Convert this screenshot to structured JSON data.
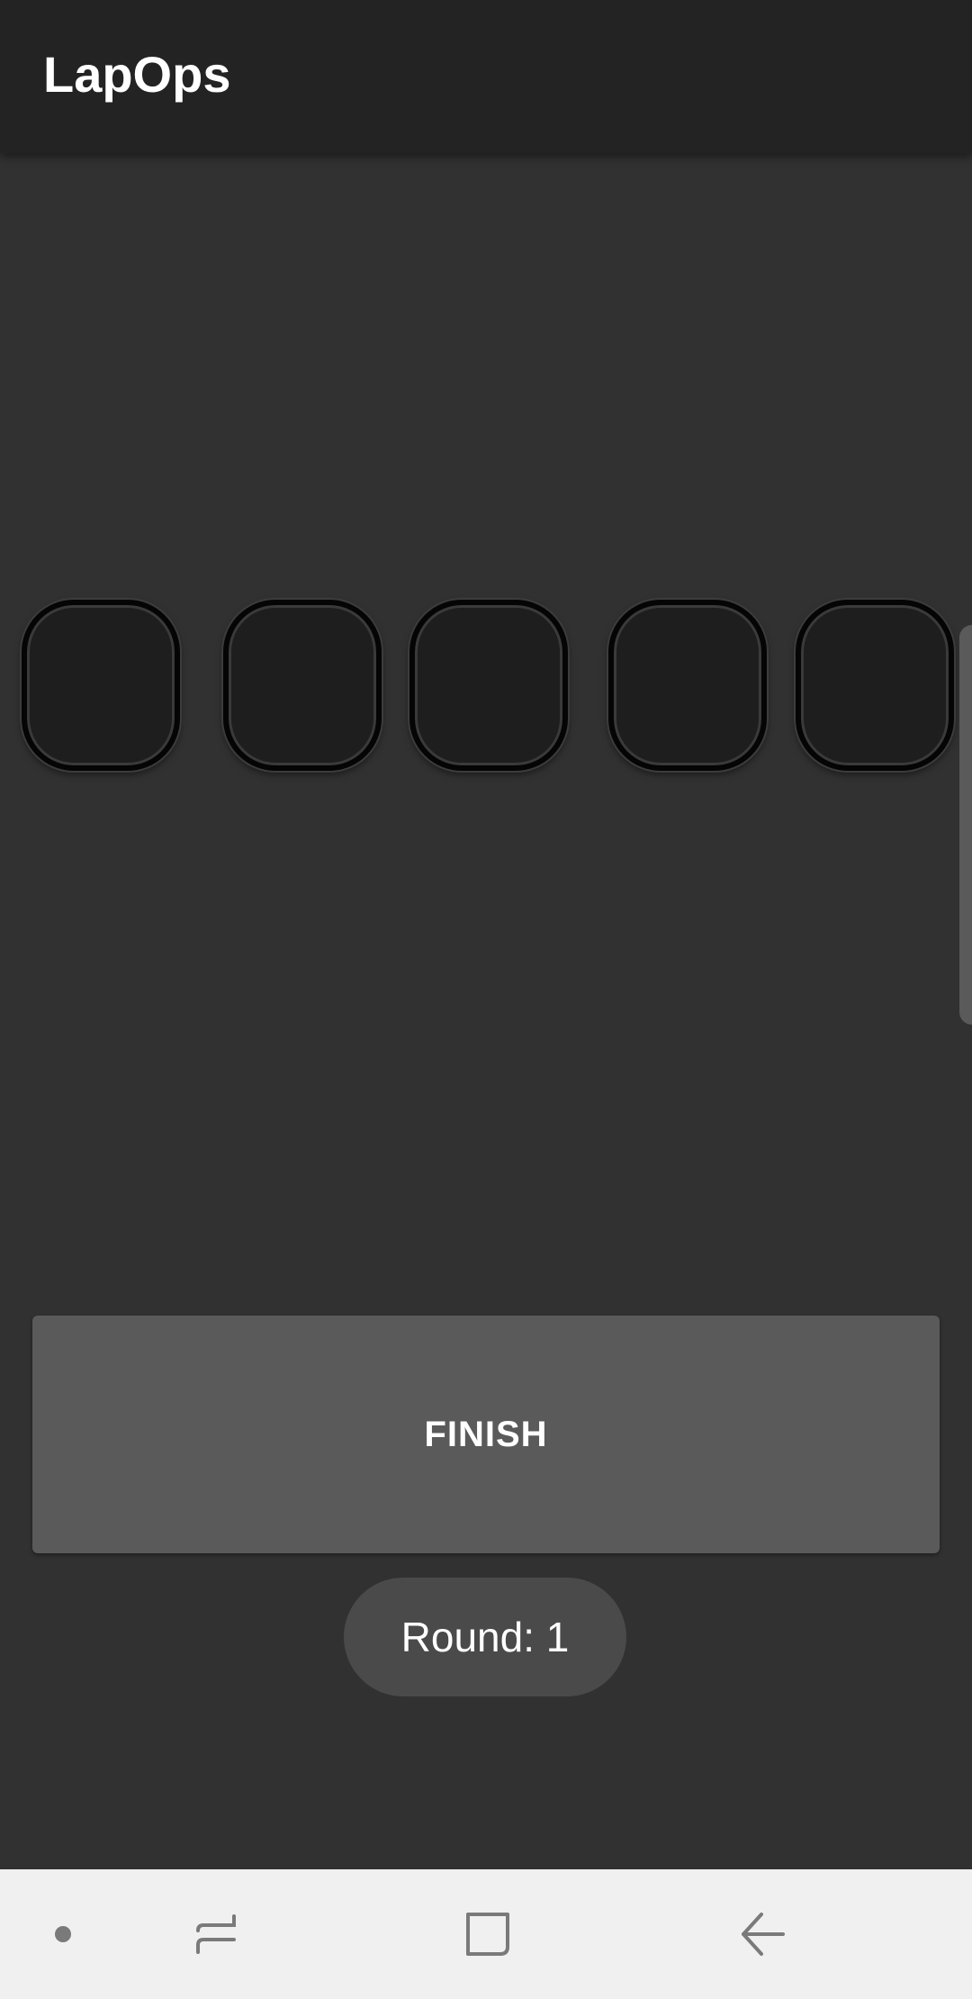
{
  "app_bar": {
    "title": "LapOps"
  },
  "slots": [
    {
      "name": "slot-1"
    },
    {
      "name": "slot-2"
    },
    {
      "name": "slot-3"
    },
    {
      "name": "slot-4"
    },
    {
      "name": "slot-5"
    }
  ],
  "finish_button": {
    "label": "FINISH"
  },
  "round": {
    "label": "Round: 1"
  },
  "nav_bar": {
    "icons": [
      "dot-icon",
      "recents-icon",
      "home-icon",
      "back-icon"
    ]
  },
  "colors": {
    "app_bar_bg": "#232323",
    "content_bg": "#313131",
    "button_bg": "#5a5a5b",
    "badge_bg": "#4a4a4a",
    "nav_bg": "#f0f0f0",
    "nav_icon": "#7a7a7a"
  }
}
